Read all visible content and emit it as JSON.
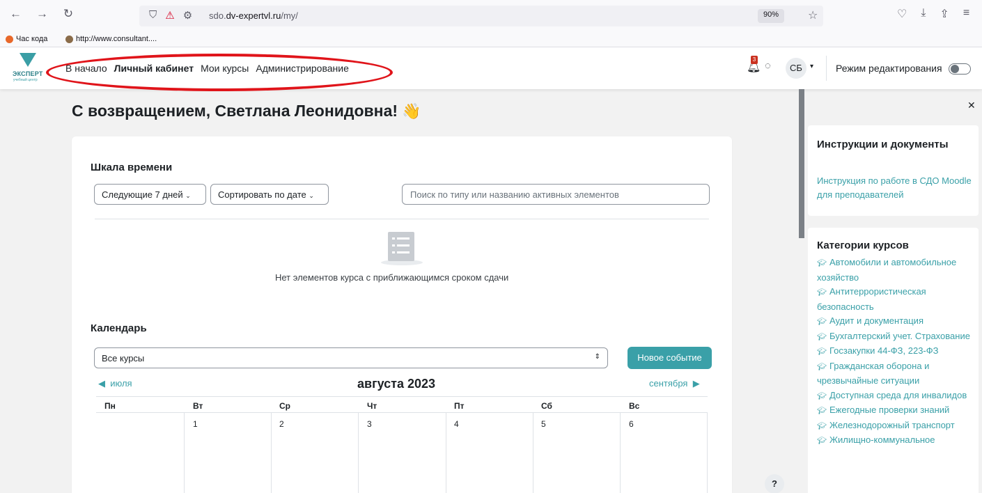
{
  "browser": {
    "url_prefix": "sdo.",
    "url_domain": "dv-expertvl.ru",
    "url_path": "/my/",
    "zoom": "90%",
    "bookmarks": [
      {
        "label": "Час кода",
        "color": "#e8682a"
      },
      {
        "label": "http://www.consultant....",
        "color": "#8a6c4a"
      }
    ]
  },
  "header": {
    "logo_text": "ЭКСПЕРТ",
    "logo_sub": "учебный центр",
    "nav": [
      "В начало",
      "Личный кабинет",
      "Мои курсы",
      "Администрирование"
    ],
    "notification_count": "3",
    "avatar_initials": "СБ",
    "edit_mode_label": "Режим редактирования"
  },
  "main": {
    "welcome": "С возвращением, Светлана Леонидовна!",
    "timeline": {
      "title": "Шкала времени",
      "range_filter": "Следующие 7 дней",
      "sort_filter": "Сортировать по дате",
      "search_placeholder": "Поиск по типу или названию активных элементов",
      "empty_text": "Нет элементов курса с приближающимся сроком сдачи"
    },
    "calendar": {
      "title": "Календарь",
      "course_filter": "Все курсы",
      "new_event": "Новое событие",
      "prev_month": "июля",
      "next_month": "сентября",
      "month_title": "августа 2023",
      "weekdays": [
        "Пн",
        "Вт",
        "Ср",
        "Чт",
        "Пт",
        "Сб",
        "Вс"
      ],
      "first_week": [
        "",
        "1",
        "2",
        "3",
        "4",
        "5",
        "6"
      ]
    }
  },
  "drawer": {
    "instructions": {
      "title": "Инструкции и документы",
      "link": "Инструкция по работе в СДО Moodle для преподавателей"
    },
    "categories": {
      "title": "Категории курсов",
      "items": [
        "Автомобили и автомобильное хозяйство",
        "Антитеррористическая безопасность",
        "Аудит и документация",
        "Бухгалтерский учет. Страхование",
        "Госзакупки 44-ФЗ, 223-ФЗ",
        "Гражданская оборона и чрезвычайные ситуации",
        "Доступная среда для инвалидов",
        "Ежегодные проверки знаний",
        "Железнодорожный транспорт",
        "Жилищно-коммунальное"
      ]
    }
  },
  "help_label": "?",
  "colors": {
    "accent": "#3aa0a8",
    "highlight": "#e0141a",
    "notification": "#ca3120"
  }
}
